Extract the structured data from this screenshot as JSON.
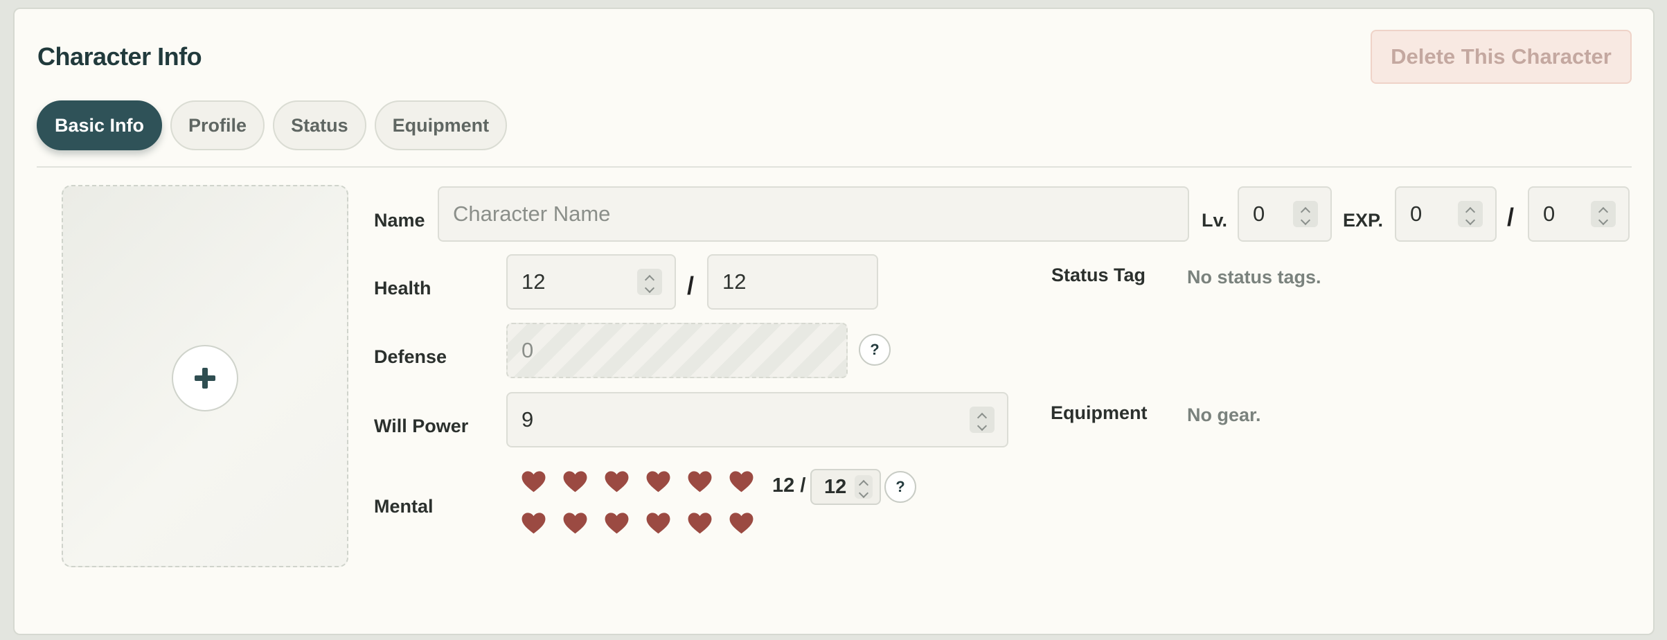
{
  "header": {
    "title": "Character Info",
    "delete_label": "Delete This Character"
  },
  "tabs": [
    {
      "label": "Basic Info",
      "active": true
    },
    {
      "label": "Profile",
      "active": false
    },
    {
      "label": "Status",
      "active": false
    },
    {
      "label": "Equipment",
      "active": false
    }
  ],
  "portrait": {
    "add_icon": "plus-icon"
  },
  "name": {
    "label": "Name",
    "placeholder": "Character Name",
    "value": ""
  },
  "level": {
    "label": "Lv.",
    "value": "0"
  },
  "exp": {
    "label": "EXP.",
    "current": "0",
    "separator": "/",
    "max": "0"
  },
  "health": {
    "label": "Health",
    "current": "12",
    "separator": "/",
    "max": "12"
  },
  "defense": {
    "label": "Defense",
    "value": "0",
    "help": "?"
  },
  "will_power": {
    "label": "Will Power",
    "value": "9"
  },
  "mental": {
    "label": "Mental",
    "hearts_filled": 12,
    "hearts_total": 12,
    "heart_color": "#9b4a42",
    "count_text": "12 /",
    "max_value": "12",
    "help": "?"
  },
  "status_tag": {
    "label": "Status Tag",
    "empty_text": "No status tags."
  },
  "equipment": {
    "label": "Equipment",
    "empty_text": "No gear."
  },
  "colors": {
    "accent": "#2f5258",
    "panel_bg": "#fcfbf6",
    "danger_bg": "#f8e9e2"
  }
}
